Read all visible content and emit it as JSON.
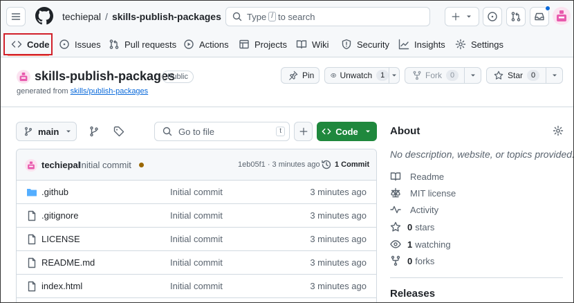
{
  "header": {
    "owner": "techiepal",
    "separator": "/",
    "repo": "skills-publish-packages",
    "search": {
      "prefix": "Type",
      "key": "/",
      "suffix": "to search"
    }
  },
  "nav": {
    "tabs": [
      {
        "label": "Code",
        "icon": "code-icon",
        "selected": true
      },
      {
        "label": "Issues",
        "icon": "issue-opened-icon"
      },
      {
        "label": "Pull requests",
        "icon": "git-pull-request-icon"
      },
      {
        "label": "Actions",
        "icon": "play-icon"
      },
      {
        "label": "Projects",
        "icon": "table-icon"
      },
      {
        "label": "Wiki",
        "icon": "book-icon"
      },
      {
        "label": "Security",
        "icon": "shield-icon"
      },
      {
        "label": "Insights",
        "icon": "graph-icon"
      },
      {
        "label": "Settings",
        "icon": "gear-icon"
      }
    ]
  },
  "repo_header": {
    "name": "skills-publish-packages",
    "visibility": "Public",
    "generated_prefix": "generated from",
    "generated_link": "skills/publish-packages",
    "pin": {
      "label": "Pin"
    },
    "watch": {
      "label": "Unwatch",
      "count": "1"
    },
    "fork": {
      "label": "Fork",
      "count": "0"
    },
    "star": {
      "label": "Star",
      "count": "0"
    }
  },
  "toolbar": {
    "branch": "main",
    "goto_placeholder": "Go to file",
    "goto_key": "t",
    "code_button": "Code"
  },
  "latest_commit": {
    "author": "techiepal",
    "message": "Initial commit",
    "status_color": "#9a6700",
    "sha_time": "1eb05f1 · 3 minutes ago",
    "commit_count": "1 Commit"
  },
  "files": [
    {
      "name": ".github",
      "type": "folder",
      "message": "Initial commit",
      "time": "3 minutes ago"
    },
    {
      "name": ".gitignore",
      "type": "file",
      "message": "Initial commit",
      "time": "3 minutes ago"
    },
    {
      "name": "LICENSE",
      "type": "file",
      "message": "Initial commit",
      "time": "3 minutes ago"
    },
    {
      "name": "README.md",
      "type": "file",
      "message": "Initial commit",
      "time": "3 minutes ago"
    },
    {
      "name": "index.html",
      "type": "file",
      "message": "Initial commit",
      "time": "3 minutes ago"
    }
  ],
  "about": {
    "title": "About",
    "description": "No description, website, or topics provided.",
    "items": [
      {
        "icon": "book-icon",
        "count": "",
        "label": "Readme"
      },
      {
        "icon": "law-icon",
        "count": "",
        "label": "MIT license"
      },
      {
        "icon": "pulse-icon",
        "count": "",
        "label": "Activity"
      },
      {
        "icon": "star-icon",
        "count": "0",
        "label": "stars"
      },
      {
        "icon": "eye-icon",
        "count": "1",
        "label": "watching"
      },
      {
        "icon": "repo-forked-icon",
        "count": "0",
        "label": "forks"
      }
    ],
    "releases_title": "Releases"
  },
  "colors": {
    "primary_green": "#1f883d",
    "link_blue": "#0969da",
    "highlight_red": "#d1202a",
    "avatar_pink": "#e85aad",
    "folder_blue": "#54aeff"
  }
}
